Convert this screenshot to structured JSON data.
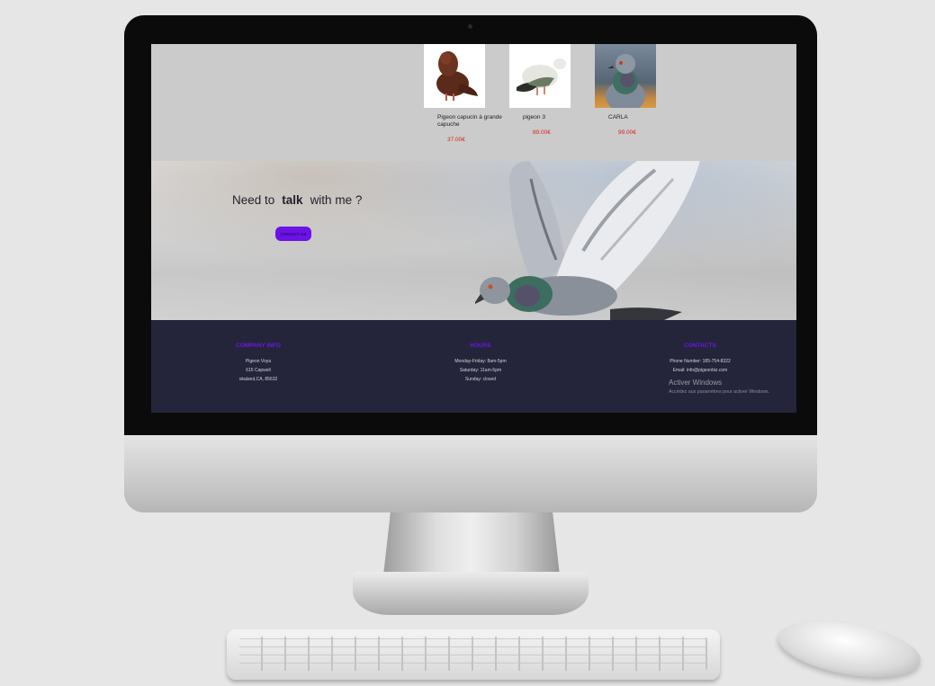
{
  "products": [
    {
      "name": "Pigeon capucin à grande capuche",
      "price": "37.00€",
      "image": "brown-pigeon-photo"
    },
    {
      "name": "pigeon 3",
      "price": "89.00€",
      "image": "white-pigeon-photo"
    },
    {
      "name": "CARLA",
      "price": "99.00€",
      "image": "grey-pigeon-photo"
    }
  ],
  "banner": {
    "heading_pre": "Need to",
    "heading_bold": "talk",
    "heading_post": "with me ?",
    "button_label": "CONTACT US"
  },
  "footer": {
    "company": {
      "title": "COMPANY INFO",
      "lines": [
        "Pigeon Voya",
        "615 Capwell",
        "okaland,CA, 85632"
      ]
    },
    "hours": {
      "title": "HOURS",
      "lines": [
        "Monday-Friday: 8am-5pm",
        "Saturday: 11am-5pm",
        "Sunday: closed"
      ]
    },
    "contacts": {
      "title": "CONTACTS",
      "lines": [
        "Phone Number: 185-754-8322",
        "Email: info@pigeonbiz.com"
      ]
    }
  },
  "windows_watermark": {
    "title": "Activer Windows",
    "subtitle": "Accédez aux paramètres pour activer Windows."
  },
  "colors": {
    "accent": "#6b12e6",
    "price": "#e0201f",
    "footer_bg": "#24253a"
  }
}
